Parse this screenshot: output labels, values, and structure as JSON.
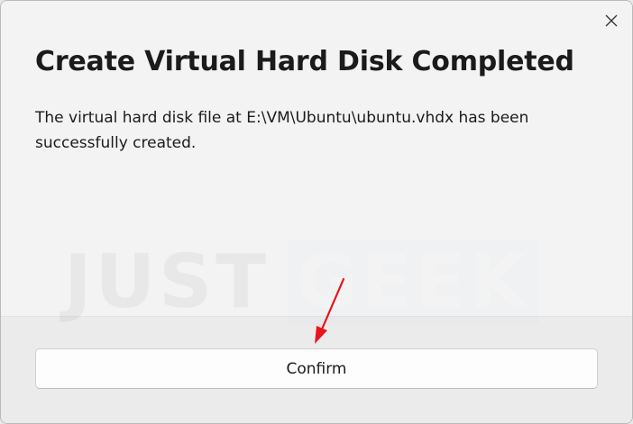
{
  "dialog": {
    "title": "Create Virtual Hard Disk Completed",
    "message": "The virtual hard disk file at E:\\VM\\Ubuntu\\ubuntu.vhdx has been successfully created.",
    "confirm_label": "Confirm",
    "close_icon": "close-icon"
  },
  "watermark": {
    "part1": "JUST",
    "part2": "GEEK"
  },
  "annotation": {
    "arrow_color": "#e8141b"
  }
}
